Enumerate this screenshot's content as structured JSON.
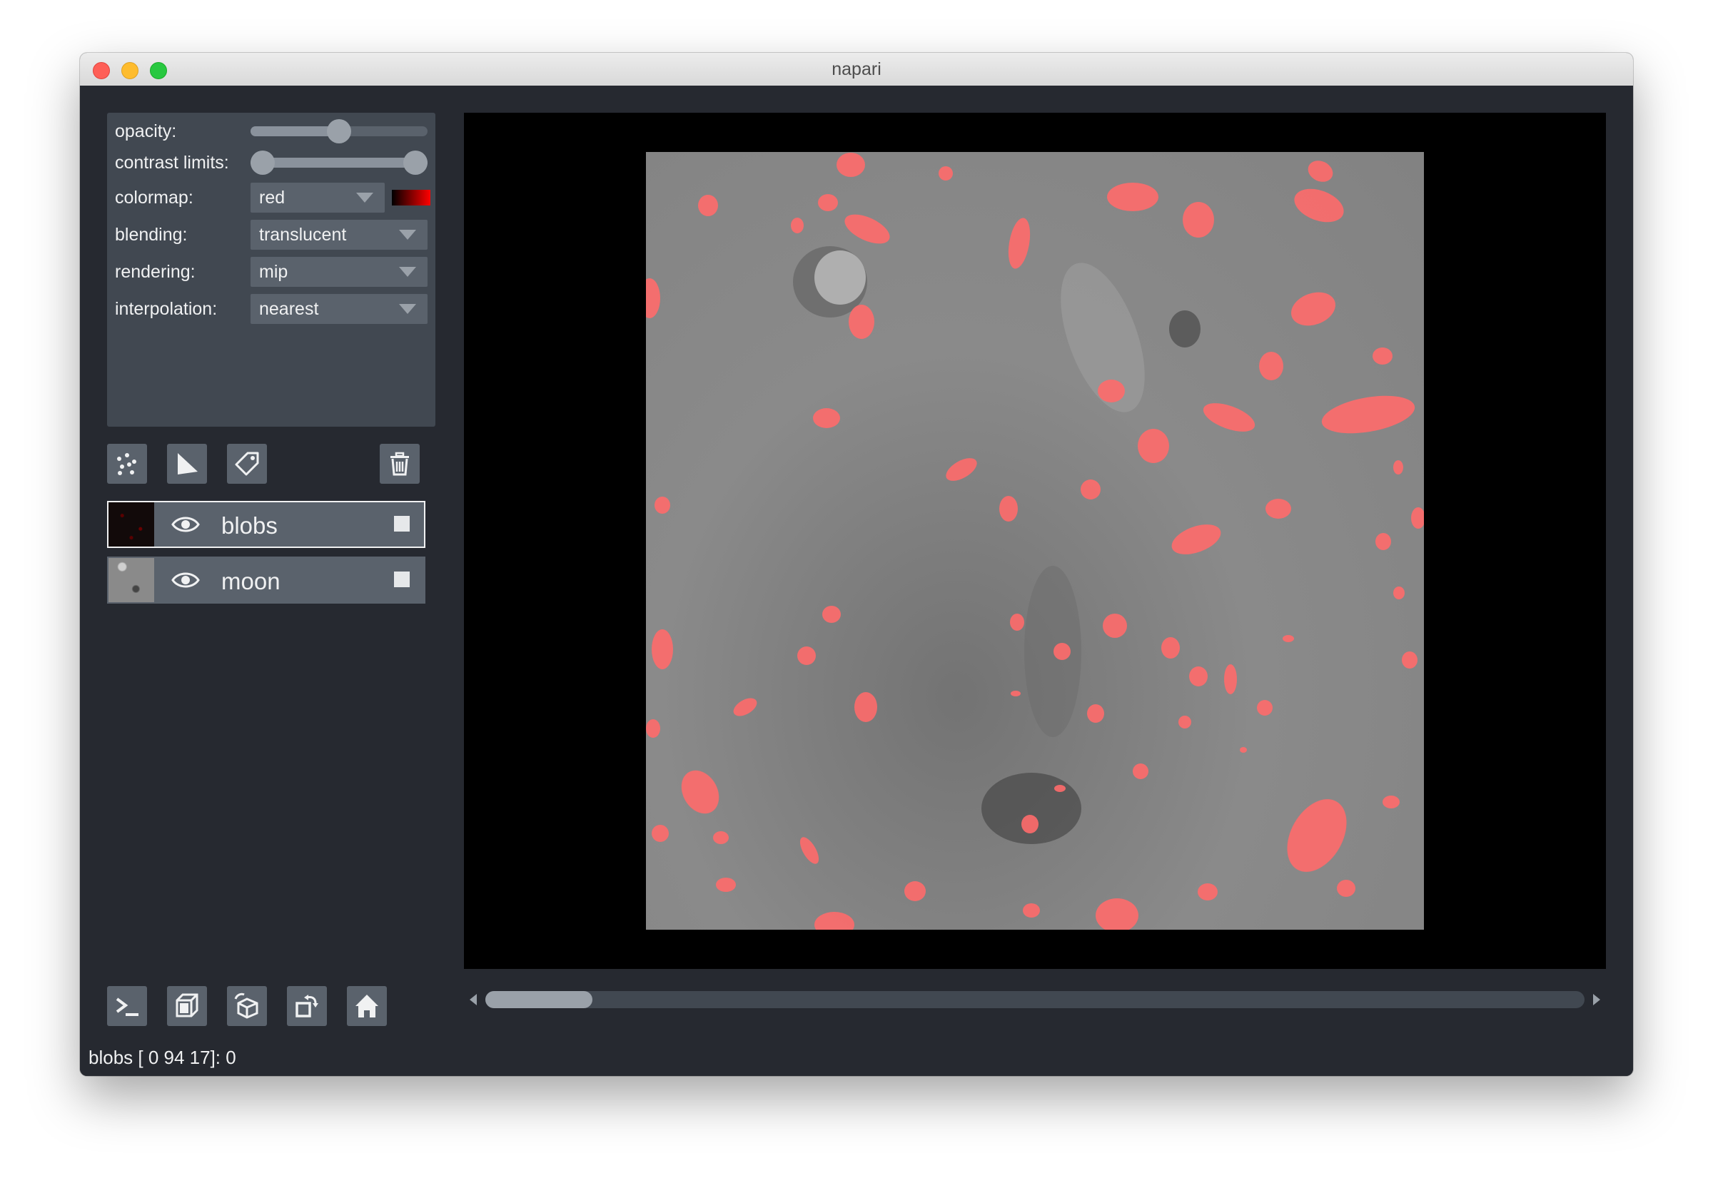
{
  "window": {
    "title": "napari"
  },
  "controls": {
    "opacity_label": "opacity:",
    "opacity_value": 0.5,
    "contrast_label": "contrast limits:",
    "contrast_range": [
      0,
      1
    ],
    "colormap_label": "colormap:",
    "colormap_value": "red",
    "blending_label": "blending:",
    "blending_value": "translucent",
    "rendering_label": "rendering:",
    "rendering_value": "mip",
    "interpolation_label": "interpolation:",
    "interpolation_value": "nearest"
  },
  "layers": [
    {
      "name": "blobs",
      "selected": true,
      "visible": true
    },
    {
      "name": "moon",
      "selected": false,
      "visible": true
    }
  ],
  "layer_buttons": [
    "new-points-icon",
    "new-shapes-icon",
    "new-labels-icon",
    "delete-layer-icon"
  ],
  "bottom_buttons": [
    "console-icon",
    "ndisplay-icon",
    "roll-dims-icon",
    "transpose-icon",
    "home-icon"
  ],
  "status": "blobs [ 0 94 17]: 0",
  "colors": {
    "background": "#262930",
    "panel": "#414851",
    "control": "#5a626c",
    "text": "#f0f1f2",
    "blob": "#ff6b6b"
  },
  "scrollbar": {
    "position": 0
  }
}
